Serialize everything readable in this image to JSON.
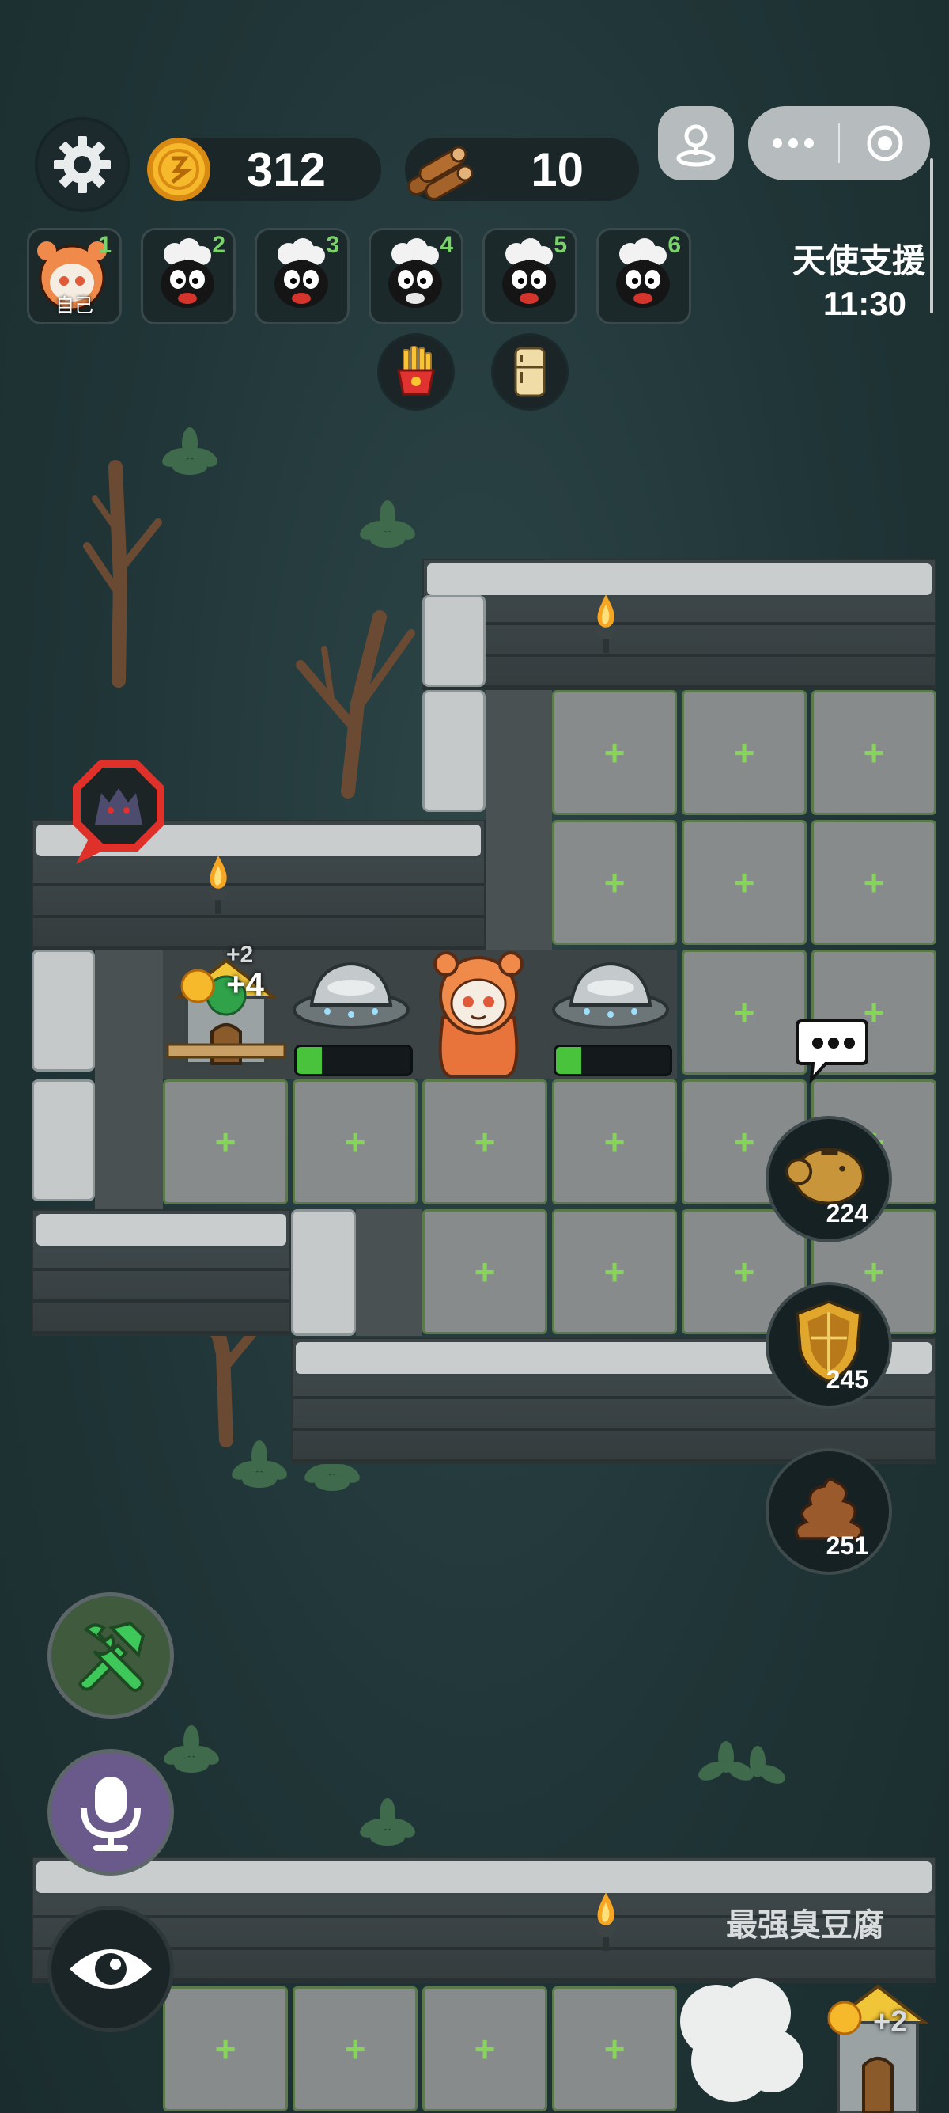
{
  "hud": {
    "coins": "312",
    "wood": "10",
    "angel_support_label": "天使支援",
    "angel_support_timer": "11:30"
  },
  "players": [
    {
      "index": "1",
      "tag": "自己"
    },
    {
      "index": "2",
      "tag": ""
    },
    {
      "index": "3",
      "tag": ""
    },
    {
      "index": "4",
      "tag": ""
    },
    {
      "index": "5",
      "tag": ""
    },
    {
      "index": "6",
      "tag": ""
    }
  ],
  "items": [
    "fries-icon",
    "fridge-icon"
  ],
  "map": {
    "plus": "+",
    "house_bonus_small": "+2",
    "house_bonus_big": "+4",
    "generator_progress": [
      0.22,
      0.22
    ],
    "bottom_house_bonus": "+2"
  },
  "resources": [
    {
      "icon": "piggy-bank-icon",
      "value": "224"
    },
    {
      "icon": "shield-icon",
      "value": "245"
    },
    {
      "icon": "poop-icon",
      "value": "251"
    }
  ],
  "opponent_name": "最强臭豆腐",
  "colors": {
    "plus": "#86d45a",
    "progress": "#49c23c",
    "background": "#203537"
  }
}
